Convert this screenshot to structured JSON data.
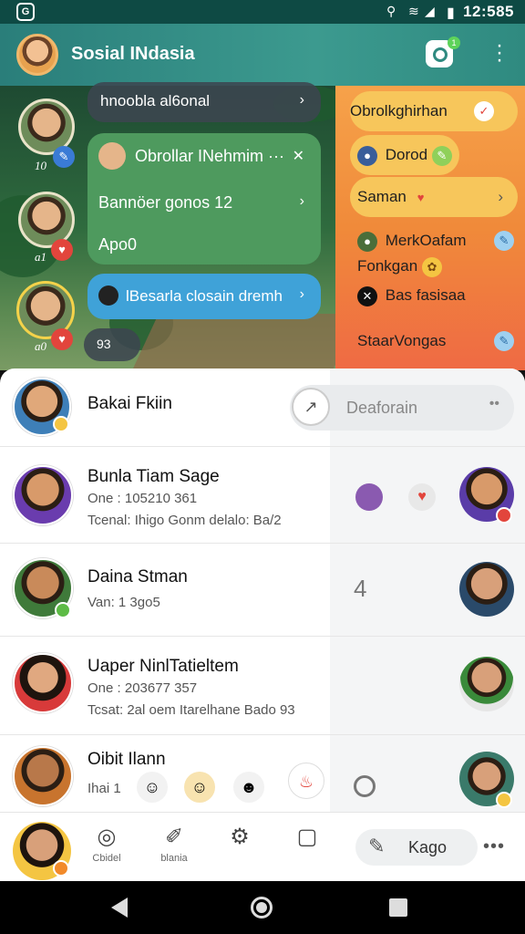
{
  "status_bar": {
    "time": "12:585",
    "signal_icons": [
      "wifi-icon",
      "signal-icon",
      "battery-icon"
    ]
  },
  "app_bar": {
    "title": "Sosial INdasia",
    "chat_badge": "1"
  },
  "scene": {
    "players": [
      {
        "label": "10",
        "badge_icon": "pencil-icon",
        "badge_color": "#3a7bd5"
      },
      {
        "label": "a1",
        "badge_icon": "heart-icon",
        "badge_color": "#e2453c"
      },
      {
        "label": "a0",
        "badge_icon": "heart-icon",
        "badge_color": "#e2453c"
      }
    ],
    "bubbles": [
      {
        "text": "hnoobla al6onal",
        "chevron": "›"
      },
      {
        "text": "Obrollar INehmim ···",
        "chevron": "✕"
      },
      {
        "text": "Bannöer gonos 12",
        "chevron": "›"
      },
      {
        "text": "Apo0",
        "chevron": ""
      },
      {
        "text": "lBesarla closain dremh",
        "chevron": "›"
      },
      {
        "text": "93",
        "chevron": ""
      }
    ],
    "side_items": [
      {
        "text": "Obrolkghirhan",
        "icon": "check-icon"
      },
      {
        "text": "Dorod",
        "icon": "pencil-icon"
      },
      {
        "text": "Saman",
        "icon": "heart-icon"
      },
      {
        "text": "MerkOafam",
        "icon": "pencil-icon"
      },
      {
        "text": "Fonkgan",
        "icon": "emoji-icon"
      },
      {
        "text": "Bas fasisaa",
        "icon": "close-icon"
      },
      {
        "text": "StaarVongas",
        "icon": "pencil-icon"
      }
    ]
  },
  "list": {
    "rows": [
      {
        "name": "Bakai Fkiin",
        "line1": "",
        "line2": ""
      },
      {
        "name": "Bunla Tiam Sage",
        "line1": "One : 105210 361",
        "line2": "Tcenal: Ihigo Gonm delalo: Ba/2"
      },
      {
        "name": "Daina Stman",
        "line1": "Van: 1 3go5",
        "line2": "",
        "right_count": "4"
      },
      {
        "name": "Uaper NinlTatieltem",
        "line1": "One : 203677 357",
        "line2": "Tcsat: 2al oem Itarelhane Bado 93"
      },
      {
        "name": "Oibit Ilann",
        "line1": "Ihai 1",
        "line2": ""
      }
    ],
    "search_placeholder": "Deaforain"
  },
  "bottom_nav": {
    "items": [
      {
        "label": "Cbidel",
        "icon": "circle-icon"
      },
      {
        "label": "blania",
        "icon": "paint-icon"
      },
      {
        "label": "",
        "icon": "gear-icon"
      },
      {
        "label": "",
        "icon": "square-icon"
      }
    ],
    "pill_label": "Kago",
    "more": "•••"
  }
}
